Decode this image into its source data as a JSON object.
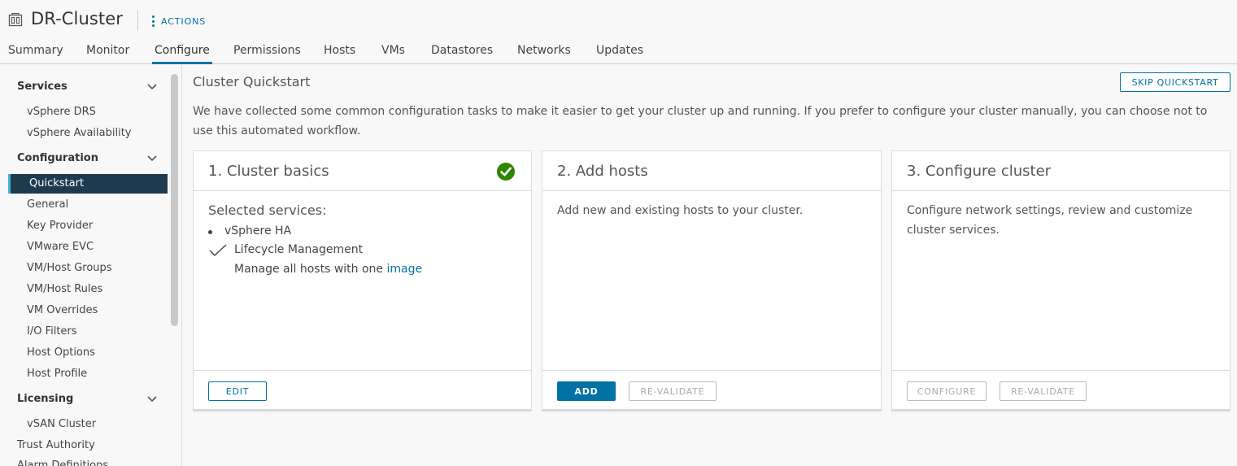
{
  "header": {
    "title": "DR-Cluster",
    "actions_label": "ACTIONS"
  },
  "tabs": [
    {
      "label": "Summary"
    },
    {
      "label": "Monitor"
    },
    {
      "label": "Configure",
      "active": true
    },
    {
      "label": "Permissions"
    },
    {
      "label": "Hosts"
    },
    {
      "label": "VMs"
    },
    {
      "label": "Datastores"
    },
    {
      "label": "Networks"
    },
    {
      "label": "Updates"
    }
  ],
  "sidebar": {
    "services": {
      "label": "Services",
      "items": [
        "vSphere DRS",
        "vSphere Availability"
      ]
    },
    "configuration": {
      "label": "Configuration",
      "items": [
        "Quickstart",
        "General",
        "Key Provider",
        "VMware EVC",
        "VM/Host Groups",
        "VM/Host Rules",
        "VM Overrides",
        "I/O Filters",
        "Host Options",
        "Host Profile"
      ]
    },
    "licensing": {
      "label": "Licensing",
      "items": [
        "vSAN Cluster"
      ]
    },
    "trust_authority": "Trust Authority",
    "alarm_definitions": "Alarm Definitions",
    "active_item": "Quickstart"
  },
  "main": {
    "title": "Cluster Quickstart",
    "skip_label": "SKIP QUICKSTART",
    "intro": "We have collected some common configuration tasks to make it easier to get your cluster up and running. If you prefer to configure your cluster manually, you can choose not to use this automated workflow.",
    "cards": [
      {
        "title": "1. Cluster basics",
        "completed": true,
        "selected_services_label": "Selected services:",
        "services": [
          "vSphere HA"
        ],
        "lifecycle_label": "Lifecycle Management",
        "lifecycle_sub_prefix": "Manage all hosts with one",
        "lifecycle_sub_link": "image",
        "edit_label": "EDIT"
      },
      {
        "title": "2. Add hosts",
        "body": "Add new and existing hosts to your cluster.",
        "add_label": "ADD",
        "revalidate_label": "RE-VALIDATE"
      },
      {
        "title": "3. Configure cluster",
        "body": "Configure network settings, review and customize cluster services.",
        "configure_label": "CONFIGURE",
        "revalidate_label": "RE-VALIDATE"
      }
    ]
  },
  "colors": {
    "accent": "#0072a3",
    "success": "#2e8500",
    "sidebar_active": "#1e3a4f"
  },
  "icons": {
    "cluster": "cluster-icon",
    "actions": "kebab-vertical-icon",
    "chevron": "chevron-down-icon",
    "success": "check-circle-icon",
    "check": "check-icon"
  }
}
